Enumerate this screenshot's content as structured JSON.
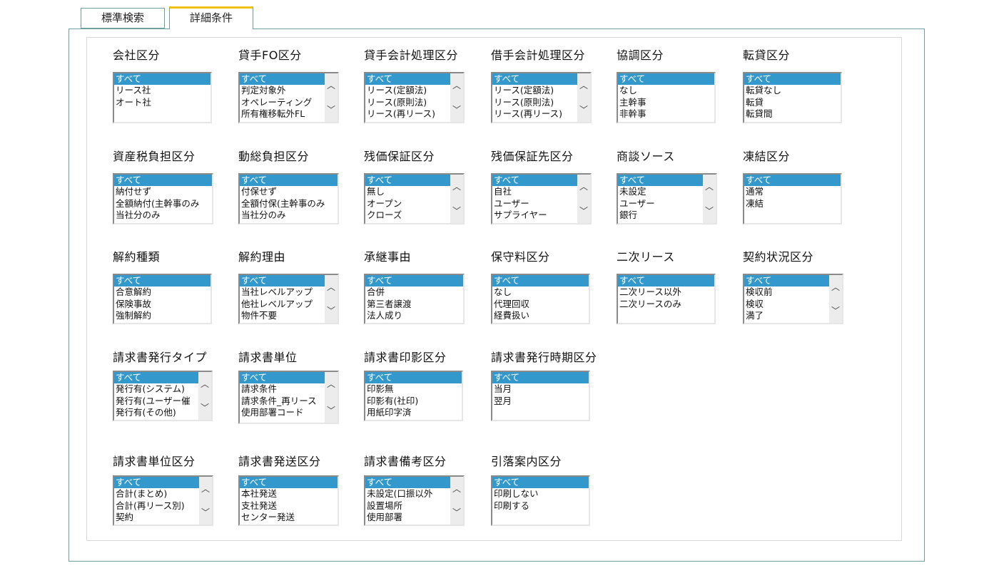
{
  "tabs": [
    {
      "label": "標準検索"
    },
    {
      "label": "詳細条件"
    }
  ],
  "fields": [
    {
      "label": "会社区分",
      "options": [
        "すべて",
        "リース社",
        "オート社"
      ],
      "scroll": false
    },
    {
      "label": "貸手FO区分",
      "options": [
        "すべて",
        "判定対象外",
        "オペレーティング",
        "所有権移転外FL"
      ],
      "scroll": true
    },
    {
      "label": "貸手会計処理区分",
      "options": [
        "すべて",
        "リース(定額法)",
        "リース(原則法)",
        "リース(再リース)"
      ],
      "scroll": true
    },
    {
      "label": "借手会計処理区分",
      "options": [
        "すべて",
        "リース(定額法)",
        "リース(原則法)",
        "リース(再リース)"
      ],
      "scroll": true
    },
    {
      "label": "協調区分",
      "options": [
        "すべて",
        "なし",
        "主幹事",
        "非幹事"
      ],
      "scroll": false
    },
    {
      "label": "転貸区分",
      "options": [
        "すべて",
        "転貸なし",
        "転貸",
        "転貸間"
      ],
      "scroll": false
    },
    {
      "label": "資産税負担区分",
      "options": [
        "すべて",
        "納付せず",
        "全額納付(主幹事のみ",
        "当社分のみ"
      ],
      "scroll": false
    },
    {
      "label": "動総負担区分",
      "options": [
        "すべて",
        "付保せず",
        "全額付保(主幹事のみ",
        "当社分のみ"
      ],
      "scroll": false
    },
    {
      "label": "残価保証区分",
      "options": [
        "すべて",
        "無し",
        "オープン",
        "クローズ"
      ],
      "scroll": true
    },
    {
      "label": "残価保証先区分",
      "options": [
        "すべて",
        "自社",
        "ユーザー",
        "サプライヤー"
      ],
      "scroll": true
    },
    {
      "label": "商談ソース",
      "options": [
        "すべて",
        "未設定",
        "ユーザー",
        "銀行"
      ],
      "scroll": true
    },
    {
      "label": "凍結区分",
      "options": [
        "すべて",
        "通常",
        "凍結"
      ],
      "scroll": false
    },
    {
      "label": "解約種類",
      "options": [
        "すべて",
        "合意解約",
        "保険事故",
        "強制解約"
      ],
      "scroll": false
    },
    {
      "label": "解約理由",
      "options": [
        "すべて",
        "当社レベルアップ",
        "他社レベルアップ",
        "物件不要"
      ],
      "scroll": true
    },
    {
      "label": "承継事由",
      "options": [
        "すべて",
        "合併",
        "第三者譲渡",
        "法人成り"
      ],
      "scroll": false
    },
    {
      "label": "保守料区分",
      "options": [
        "すべて",
        "なし",
        "代理回収",
        "経費扱い"
      ],
      "scroll": false
    },
    {
      "label": "二次リース",
      "options": [
        "すべて",
        "二次リース以外",
        "二次リースのみ"
      ],
      "scroll": false
    },
    {
      "label": "契約状況区分",
      "options": [
        "すべて",
        "検収前",
        "検収",
        "満了"
      ],
      "scroll": true
    },
    {
      "label": "請求書発行タイプ",
      "options": [
        "すべて",
        "発行有(システム)",
        "発行有(ユーザー催",
        "発行有(その他)"
      ],
      "scroll": true
    },
    {
      "label": "請求書単位",
      "options": [
        "すべて",
        "請求条件",
        "請求条件_再リース",
        "使用部署コード"
      ],
      "scroll": true
    },
    {
      "label": "請求書印影区分",
      "options": [
        "すべて",
        "印影無",
        "印影有(社印)",
        "用紙印字済"
      ],
      "scroll": false
    },
    {
      "label": "請求書発行時期区分",
      "options": [
        "すべて",
        "当月",
        "翌月"
      ],
      "scroll": false
    },
    {
      "label": "請求書単位区分",
      "options": [
        "すべて",
        "合計(まとめ)",
        "合計(再リース別)",
        "契約"
      ],
      "scroll": true
    },
    {
      "label": "請求書発送区分",
      "options": [
        "すべて",
        "本社発送",
        "支社発送",
        "センター発送"
      ],
      "scroll": false
    },
    {
      "label": "請求書備考区分",
      "options": [
        "すべて",
        "未設定(口振以外",
        "設置場所",
        "使用部署"
      ],
      "scroll": true
    },
    {
      "label": "引落案内区分",
      "options": [
        "すべて",
        "印刷しない",
        "印刷する"
      ],
      "scroll": false
    }
  ]
}
